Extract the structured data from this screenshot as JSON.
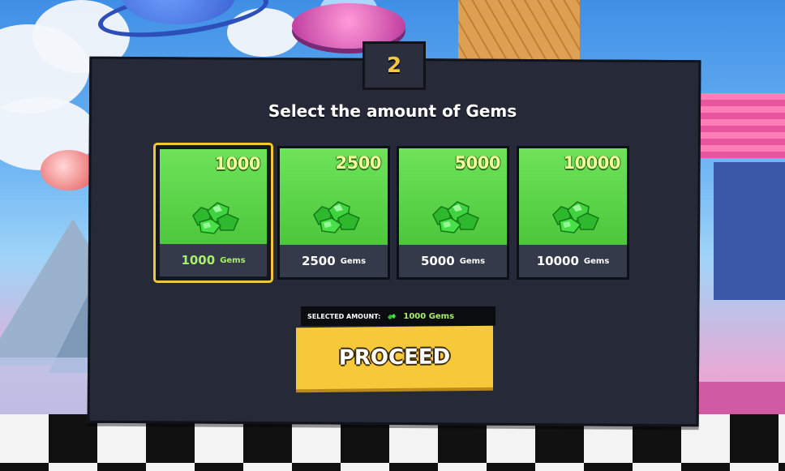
{
  "step": {
    "number": "2"
  },
  "title": "Select the amount of Gems",
  "options": [
    {
      "amount": "1000",
      "label_num": "1000",
      "label_unit": "Gems",
      "selected": true
    },
    {
      "amount": "2500",
      "label_num": "2500",
      "label_unit": "Gems",
      "selected": false
    },
    {
      "amount": "5000",
      "label_num": "5000",
      "label_unit": "Gems",
      "selected": false
    },
    {
      "amount": "10000",
      "label_num": "10000",
      "label_unit": "Gems",
      "selected": false
    }
  ],
  "selection": {
    "label": "SELECTED AMOUNT:",
    "value": "1000 Gems"
  },
  "proceed_label": "PROCEED",
  "colors": {
    "accent": "#f5c93a",
    "gem_green": "#4cc63c",
    "panel": "#262a38",
    "selected_text": "#a6f06a"
  },
  "icons": {
    "gem": "gem-pile-icon",
    "small_gem": "gem-icon"
  }
}
